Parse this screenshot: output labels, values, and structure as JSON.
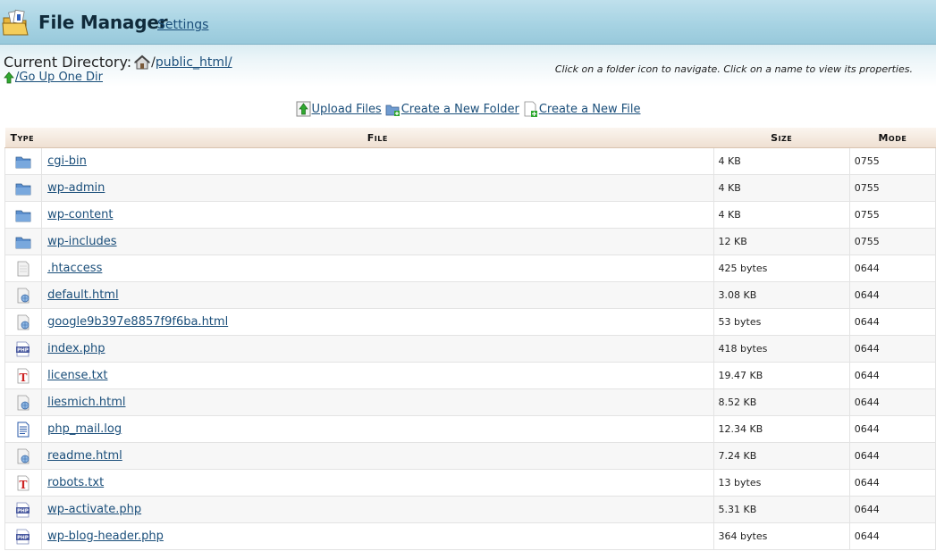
{
  "header": {
    "title": "File Manager",
    "settings_label": "Settings"
  },
  "location": {
    "label": "Current Directory:",
    "separator": "/",
    "path": "public_html/",
    "go_up_label": "/Go Up One Dir"
  },
  "help_text": "Click on a folder icon to navigate. Click on a name to view its properties.",
  "actions": [
    {
      "label": "Upload Files",
      "icon": "upload-icon"
    },
    {
      "label": "Create a New Folder",
      "icon": "new-folder-icon"
    },
    {
      "label": "Create a New File",
      "icon": "new-file-icon"
    }
  ],
  "table": {
    "headers": {
      "type": "Type",
      "file": "File",
      "size": "Size",
      "mode": "Mode"
    },
    "rows": [
      {
        "icon": "folder",
        "name": "cgi-bin",
        "size": "4 KB",
        "mode": "0755"
      },
      {
        "icon": "folder",
        "name": "wp-admin",
        "size": "4 KB",
        "mode": "0755"
      },
      {
        "icon": "folder",
        "name": "wp-content",
        "size": "4 KB",
        "mode": "0755"
      },
      {
        "icon": "folder",
        "name": "wp-includes",
        "size": "12 KB",
        "mode": "0755"
      },
      {
        "icon": "generic",
        "name": ".htaccess",
        "size": "425 bytes",
        "mode": "0644"
      },
      {
        "icon": "html",
        "name": "default.html",
        "size": "3.08 KB",
        "mode": "0644"
      },
      {
        "icon": "html",
        "name": "google9b397e8857f9f6ba.html",
        "size": "53 bytes",
        "mode": "0644"
      },
      {
        "icon": "php",
        "name": "index.php",
        "size": "418 bytes",
        "mode": "0644"
      },
      {
        "icon": "text",
        "name": "license.txt",
        "size": "19.47 KB",
        "mode": "0644"
      },
      {
        "icon": "html",
        "name": "liesmich.html",
        "size": "8.52 KB",
        "mode": "0644"
      },
      {
        "icon": "log",
        "name": "php_mail.log",
        "size": "12.34 KB",
        "mode": "0644"
      },
      {
        "icon": "html",
        "name": "readme.html",
        "size": "7.24 KB",
        "mode": "0644"
      },
      {
        "icon": "text",
        "name": "robots.txt",
        "size": "13 bytes",
        "mode": "0644"
      },
      {
        "icon": "php",
        "name": "wp-activate.php",
        "size": "5.31 KB",
        "mode": "0644"
      },
      {
        "icon": "php",
        "name": "wp-blog-header.php",
        "size": "364 bytes",
        "mode": "0644"
      }
    ]
  }
}
